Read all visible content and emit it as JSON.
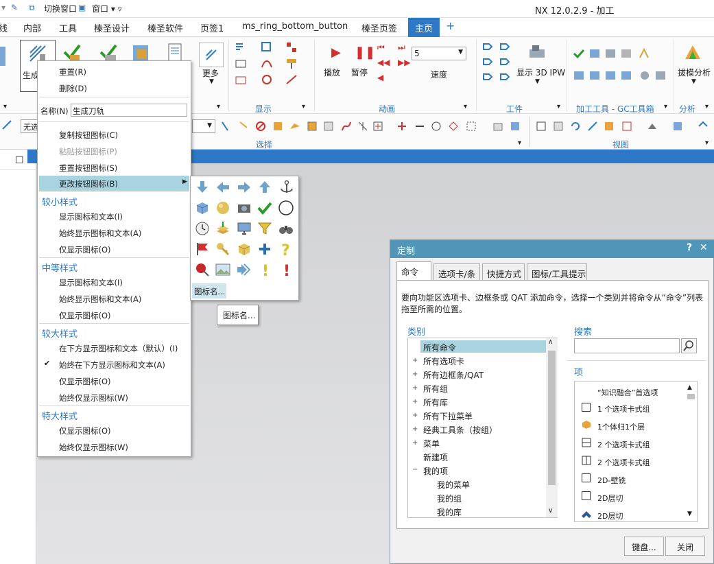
{
  "quick_access": {
    "switch_window": "切换窗口",
    "window_menu": "窗口"
  },
  "app_title": "NX 12.0.2.9 - 加工",
  "tabs": [
    "线",
    "内部",
    "工具",
    "榛圣设计",
    "榛圣软件",
    "页签1",
    "ms_ring_bottom_button",
    "榛圣页签",
    "主页"
  ],
  "ribbon": {
    "generate_label": "生成",
    "more_label": "更多",
    "play_label": "播放",
    "pause_label": "暂停",
    "speed_value": "5",
    "speed_label": "速度",
    "show_ipw_label": "显示 3D IPW",
    "draft_analysis_label": "拔模分析",
    "group_display": "显示",
    "group_animation": "动画",
    "group_workpiece": "工件",
    "group_gc": "加工工具 - GC工具箱",
    "group_analysis": "分析",
    "group_select": "选择",
    "group_view": "视图",
    "filter_value": "无选"
  },
  "context_menu": {
    "reset": "重置(R)",
    "delete": "删除(D)",
    "name_label": "名称(N)",
    "name_value": "生成刀轨",
    "copy_icon": "复制按钮图标(C)",
    "paste_icon": "粘贴按钮图标(P)",
    "reset_icon": "重置按钮图标(S)",
    "change_icon": "更改按钮图标(B)",
    "small_header": "较小样式",
    "small_1": "显示图标和文本(I)",
    "small_2": "始终显示图标和文本(A)",
    "small_3": "仅显示图标(O)",
    "medium_header": "中等样式",
    "medium_1": "显示图标和文本(I)",
    "medium_2": "始终显示图标和文本(A)",
    "medium_3": "仅显示图标(O)",
    "large_header": "较大样式",
    "large_1": "在下方显示图标和文本（默认）(I)",
    "large_2": "始终在下方显示图标和文本(A)",
    "large_3": "仅显示图标(O)",
    "large_4": "始终仅显示图标(W)",
    "xlarge_header": "特大样式",
    "xlarge_1": "仅显示图标(O)",
    "xlarge_2": "始终仅显示图标(W)"
  },
  "icon_submenu": {
    "icon_name_link": "图标名...",
    "tooltip": "图标名..."
  },
  "dialog": {
    "title": "定制",
    "help": "?",
    "close": "✕",
    "tabs": [
      "命令",
      "选项卡/条",
      "快捷方式",
      "图标/工具提示"
    ],
    "instructions": "要向功能区选项卡、边框条或 QAT 添加命令，选择一个类别并将命令从“命令”列表拖至所需的位置。",
    "category_label": "类别",
    "categories": [
      "所有命令",
      "所有选项卡",
      "所有边框条/QAT",
      "所有组",
      "所有库",
      "所有下拉菜单",
      "经典工具条（按组）",
      "菜单",
      "新建项",
      "我的项",
      "我的菜单",
      "我的组",
      "我的库"
    ],
    "search_label": "搜索",
    "search_value": "",
    "items_label": "项",
    "items": [
      "“知识融合”首选项",
      "1 个选项卡式组",
      "1个体归1个层",
      "2 个选项卡式组",
      "2 个选项卡式组",
      "2D-壁铣",
      "2D层切",
      "2D层切"
    ],
    "keyboard_button": "键盘...",
    "close_button": "关闭"
  },
  "colors": {
    "accent": "#2d79c7",
    "dialog_title": "#4f96b9",
    "highlight": "#a8d3e0"
  }
}
